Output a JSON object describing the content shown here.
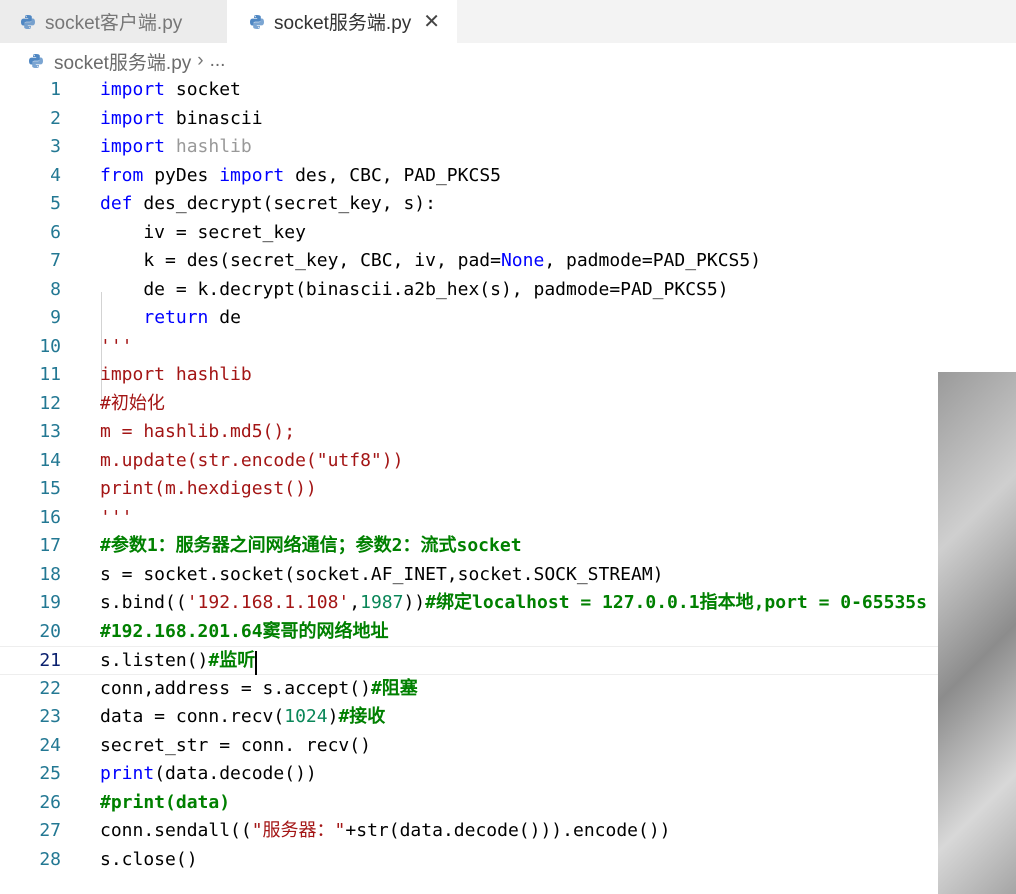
{
  "tabs": [
    {
      "label": "socket客户端.py",
      "icon": "python-file-icon",
      "active": false
    },
    {
      "label": "socket服务端.py",
      "icon": "python-file-icon",
      "active": true,
      "close": "✕"
    }
  ],
  "breadcrumb": {
    "file": "socket服务端.py",
    "separator": "›",
    "more": "..."
  },
  "editor": {
    "current_line": 21,
    "line_numbers": [
      "1",
      "2",
      "3",
      "4",
      "5",
      "6",
      "7",
      "8",
      "9",
      "10",
      "11",
      "12",
      "13",
      "14",
      "15",
      "16",
      "17",
      "18",
      "19",
      "20",
      "21",
      "22",
      "23",
      "24",
      "25",
      "26",
      "27",
      "28"
    ],
    "lines": [
      [
        {
          "t": "import",
          "c": "kw"
        },
        {
          "t": " socket"
        }
      ],
      [
        {
          "t": "import",
          "c": "kw"
        },
        {
          "t": " binascii"
        }
      ],
      [
        {
          "t": "import",
          "c": "kw"
        },
        {
          "t": " hashlib",
          "c": "dim"
        }
      ],
      [
        {
          "t": "from",
          "c": "kw"
        },
        {
          "t": " pyDes "
        },
        {
          "t": "import",
          "c": "kw"
        },
        {
          "t": " des, CBC, PAD_PKCS5"
        }
      ],
      [
        {
          "t": "def",
          "c": "kw"
        },
        {
          "t": " des_decrypt(secret_key, s):"
        }
      ],
      [
        {
          "t": "    iv = secret_key"
        }
      ],
      [
        {
          "t": "    k = des(secret_key, CBC, iv, pad="
        },
        {
          "t": "None",
          "c": "kw"
        },
        {
          "t": ", padmode=PAD_PKCS5)"
        }
      ],
      [
        {
          "t": "    de = k.decrypt(binascii.a2b_hex(s), padmode=PAD_PKCS5)"
        }
      ],
      [
        {
          "t": "    "
        },
        {
          "t": "return",
          "c": "kw"
        },
        {
          "t": " de"
        }
      ],
      [
        {
          "t": "'''",
          "c": "red"
        }
      ],
      [
        {
          "t": "import hashlib",
          "c": "red"
        }
      ],
      [
        {
          "t": "#初始化",
          "c": "red"
        }
      ],
      [
        {
          "t": "m = hashlib.md5();",
          "c": "red"
        }
      ],
      [
        {
          "t": "m.update(str.encode(\"utf8\"))",
          "c": "red"
        }
      ],
      [
        {
          "t": "print(m.hexdigest())",
          "c": "red"
        }
      ],
      [
        {
          "t": "'''",
          "c": "red"
        }
      ],
      [
        {
          "t": "#参数1：服务器之间网络通信；参数2：流式socket",
          "c": "cm"
        }
      ],
      [
        {
          "t": "s = socket.socket(socket.AF_INET,socket.SOCK_STREAM)"
        }
      ],
      [
        {
          "t": "s.bind(("
        },
        {
          "t": "'192.168.1.108'",
          "c": "str"
        },
        {
          "t": ","
        },
        {
          "t": "1987",
          "c": "num"
        },
        {
          "t": "))"
        },
        {
          "t": "#绑定localhost = 127.0.0.1指本地,port = 0-65535s",
          "c": "cm"
        }
      ],
      [
        {
          "t": "#192.168.201.64窦哥的网络地址",
          "c": "cm"
        }
      ],
      [
        {
          "t": "s.listen()"
        },
        {
          "t": "#监听",
          "c": "cm"
        }
      ],
      [
        {
          "t": "conn,address = s.accept()"
        },
        {
          "t": "#阻塞",
          "c": "cm"
        }
      ],
      [
        {
          "t": "data = conn.recv("
        },
        {
          "t": "1024",
          "c": "num"
        },
        {
          "t": ")"
        },
        {
          "t": "#接收",
          "c": "cm"
        }
      ],
      [
        {
          "t": "secret_str = conn. recv()"
        }
      ],
      [
        {
          "t": "print",
          "c": "kw"
        },
        {
          "t": "(data.decode())"
        }
      ],
      [
        {
          "t": "#print(data)",
          "c": "cm"
        }
      ],
      [
        {
          "t": "conn.sendall(("
        },
        {
          "t": "\"服务器：\"",
          "c": "str"
        },
        {
          "t": "+str(data.decode())).encode())"
        }
      ],
      [
        {
          "t": "s.close()"
        }
      ]
    ]
  },
  "colors": {
    "keyword": "#0000ff",
    "dead_code": "#a31515",
    "comment": "#008000",
    "number": "#098658",
    "line_number": "#237893"
  }
}
